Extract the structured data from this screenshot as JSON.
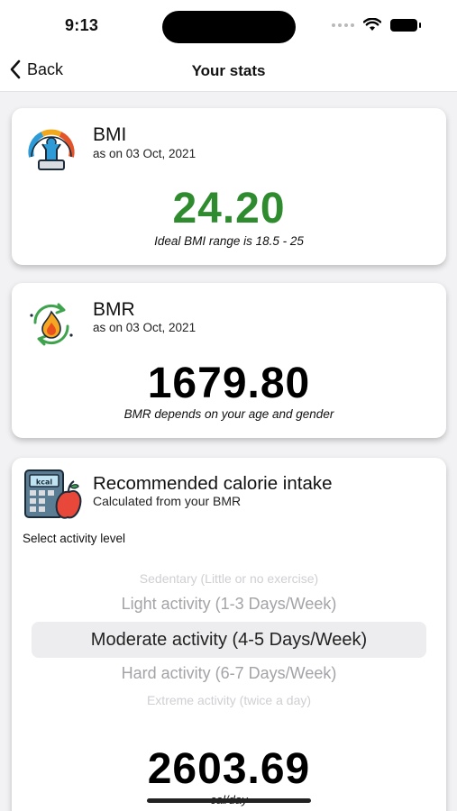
{
  "status_bar": {
    "time": "9:13"
  },
  "nav": {
    "back_label": "Back",
    "title": "Your stats"
  },
  "bmi": {
    "title": "BMI",
    "date": "as on 03 Oct, 2021",
    "value": "24.20",
    "value_color": "#2e8b2e",
    "hint": "Ideal BMI range is 18.5 - 25"
  },
  "bmr": {
    "title": "BMR",
    "date": "as on 03 Oct, 2021",
    "value": "1679.80",
    "hint": "BMR depends on your age and gender"
  },
  "calorie": {
    "title": "Recommended calorie intake",
    "subtitle": "Calculated from your BMR",
    "select_label": "Select activity level",
    "icon_text": "kcal",
    "options": [
      "Sedentary (Little or no exercise)",
      "Light activity (1-3 Days/Week)",
      "Moderate activity (4-5 Days/Week)",
      "Hard activity (6-7 Days/Week)",
      "Extreme activity (twice a day)"
    ],
    "selected_index": 2,
    "value": "2603.69",
    "unit": "cal/day"
  },
  "icons": {
    "back": "chevron-left-icon",
    "wifi": "wifi-icon",
    "battery": "battery-icon",
    "bmi": "bmi-gauge-person-icon",
    "bmr": "bmr-flame-cycle-icon",
    "calorie": "calculator-apple-icon"
  }
}
